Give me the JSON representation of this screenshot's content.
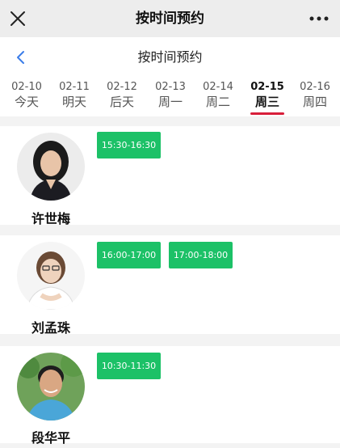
{
  "app_bar": {
    "title": "按时间预约",
    "close_icon": "close-icon",
    "more_icon": "more-icon"
  },
  "header": {
    "title": "按时间预约",
    "back_icon": "chevron-left-icon"
  },
  "date_tabs": [
    {
      "date": "02-10",
      "day": "今天"
    },
    {
      "date": "02-11",
      "day": "明天"
    },
    {
      "date": "02-12",
      "day": "后天"
    },
    {
      "date": "02-13",
      "day": "周一"
    },
    {
      "date": "02-14",
      "day": "周二"
    },
    {
      "date": "02-15",
      "day": "周三",
      "selected": true
    },
    {
      "date": "02-16",
      "day": "周四"
    }
  ],
  "doctors": [
    {
      "name": "许世梅",
      "slots": [
        "15:30-16:30"
      ]
    },
    {
      "name": "刘孟珠",
      "slots": [
        "16:00-17:00",
        "17:00-18:00"
      ]
    },
    {
      "name": "段华平",
      "slots": [
        "10:30-11:30"
      ]
    }
  ],
  "colors": {
    "slot_green": "#1cc167",
    "tab_underline": "#d81e3a",
    "accent_blue": "#3b7de9"
  }
}
